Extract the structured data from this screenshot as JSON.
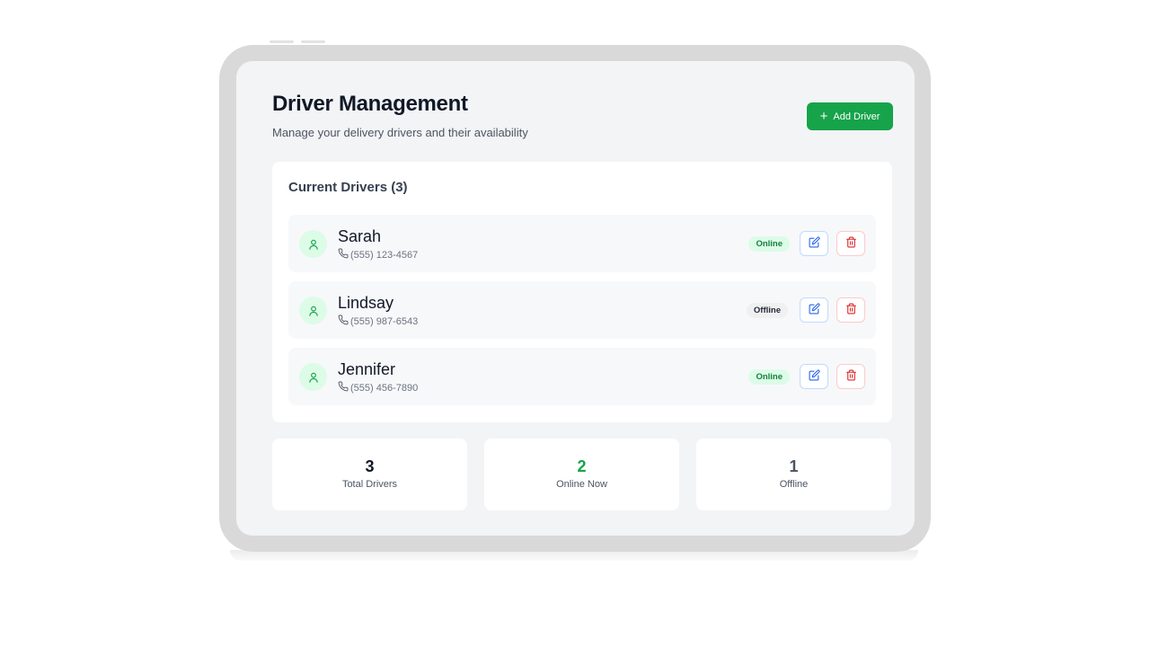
{
  "header": {
    "title": "Driver Management",
    "subtitle": "Manage your delivery drivers and their availability",
    "add_button_icon": "plus-icon",
    "add_button_label": "Add Driver"
  },
  "drivers_card": {
    "title": "Current Drivers (3)"
  },
  "drivers": [
    {
      "name": "Sarah",
      "phone": "(555) 123-4567",
      "status": "Online"
    },
    {
      "name": "Lindsay",
      "phone": "(555) 987-6543",
      "status": "Offline"
    },
    {
      "name": "Jennifer",
      "phone": "(555) 456-7890",
      "status": "Online"
    }
  ],
  "icons": {
    "avatar": "user-icon",
    "phone": "phone-icon",
    "edit": "edit-icon",
    "delete": "trash-icon"
  },
  "stats": [
    {
      "value": "3",
      "label": "Total Drivers"
    },
    {
      "value": "2",
      "label": "Online Now"
    },
    {
      "value": "1",
      "label": "Offline"
    }
  ],
  "colors": {
    "accent": "#16a34a",
    "online_badge_bg": "#dcfce7",
    "online_badge_text": "#15803d",
    "offline_badge_bg": "#f0f0f0",
    "edit": "#2563eb",
    "delete": "#dc2626"
  }
}
